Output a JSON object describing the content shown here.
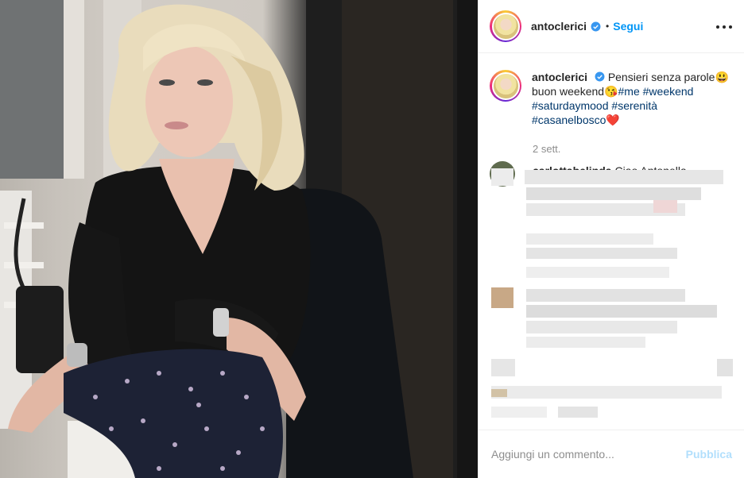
{
  "post": {
    "username": "antoclerici",
    "verified_icon": "verified-badge-icon",
    "separator": "•",
    "follow_label": "Segui",
    "more_icon": "more-options-icon"
  },
  "caption": {
    "username": "antoclerici",
    "text_1": "Pensieri senza parole😃",
    "text_2": "buon weekend😘",
    "hashtags": [
      "#me",
      "#weekend",
      "#saturdaymood",
      "#serenità",
      "#casanelbosco"
    ],
    "heart": "❤️",
    "time": "2 sett."
  },
  "comments": {
    "first_user": "carlottabelinda",
    "first_text": "Ciao Antonella"
  },
  "footer": {
    "placeholder": "Aggiungi un commento...",
    "publish_label": "Pubblica"
  },
  "colors": {
    "link_blue": "#0095f6",
    "hashtag": "#00376b",
    "muted": "#8e8e8e",
    "publish_disabled": "#b2dffc"
  }
}
